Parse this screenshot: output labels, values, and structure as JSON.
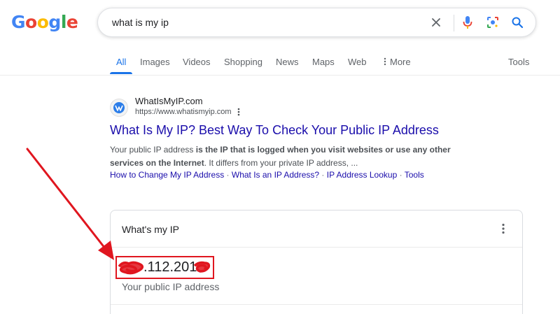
{
  "logo": {
    "letters": [
      "G",
      "o",
      "o",
      "g",
      "l",
      "e"
    ],
    "colors": [
      "#4285F4",
      "#EA4335",
      "#FBBC05",
      "#4285F4",
      "#34A853",
      "#EA4335"
    ]
  },
  "search": {
    "query": "what is my ip",
    "icons": [
      "close-icon",
      "mic-icon",
      "lens-icon",
      "search-icon"
    ]
  },
  "tabs": [
    {
      "label": "All",
      "active": true
    },
    {
      "label": "Images"
    },
    {
      "label": "Videos"
    },
    {
      "label": "Shopping"
    },
    {
      "label": "News"
    },
    {
      "label": "Maps"
    },
    {
      "label": "Web"
    },
    {
      "label": "More"
    },
    {
      "label": "Tools"
    }
  ],
  "result": {
    "site_name": "WhatIsMyIP.com",
    "url": "https://www.whatismyip.com",
    "title": "What Is My IP? Best Way To Check Your Public IP Address",
    "snippet_pre": "Your public IP address ",
    "snippet_bold1": "is the IP that is logged when you visit websites or use any other services on the Internet",
    "snippet_post": ". It differs from your private IP address, ...",
    "sitelinks": [
      "How to Change My IP Address",
      "What Is an IP Address?",
      "IP Address Lookup",
      "Tools"
    ]
  },
  "ip_card": {
    "title": "What's my IP",
    "ip_visible": ".112.201.",
    "label": "Your public IP address"
  },
  "annotation": {
    "color": "#e0161f"
  }
}
